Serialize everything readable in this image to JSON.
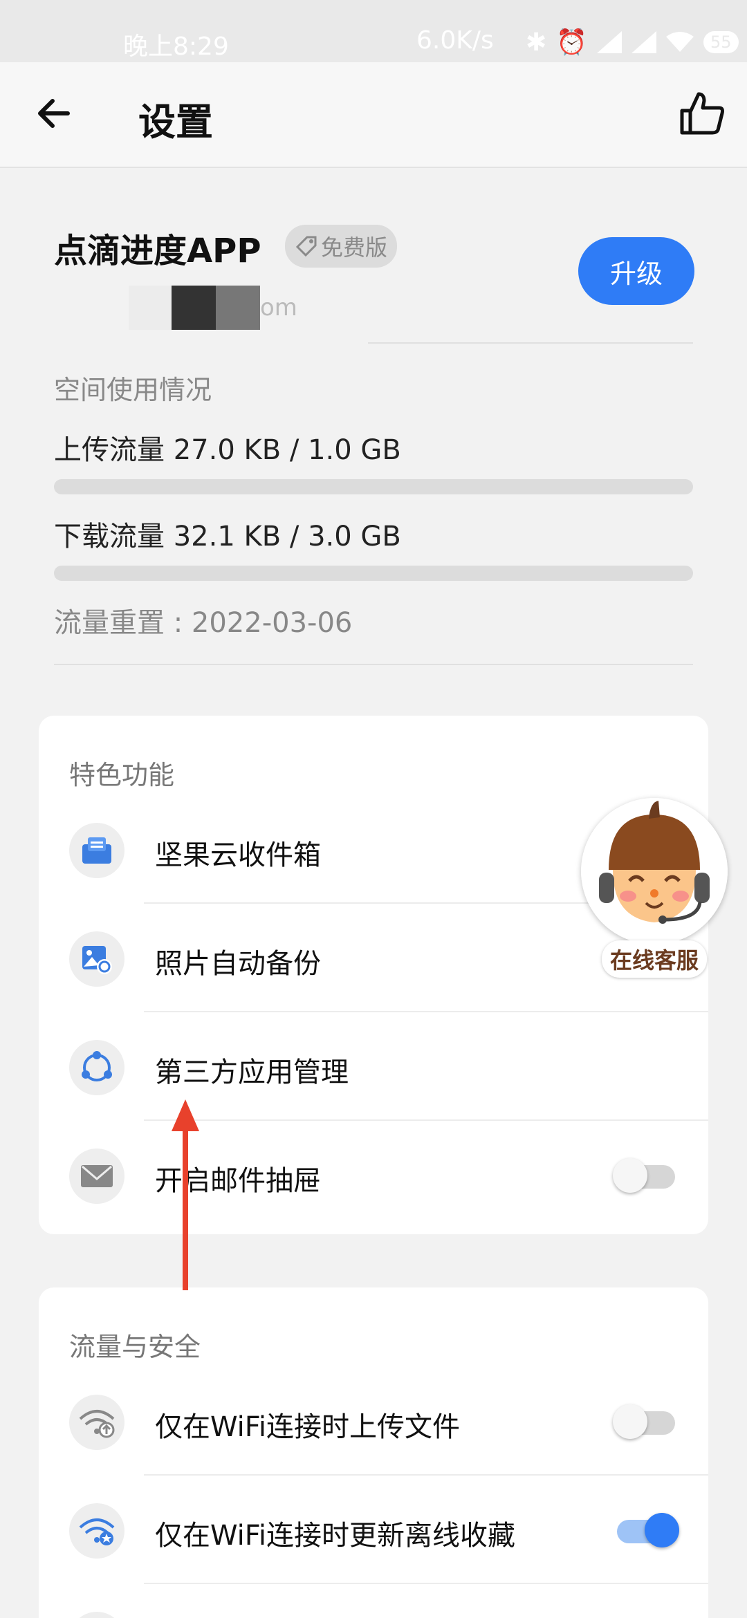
{
  "status_bar": {
    "time": "晚上8:29",
    "speed": "6.0K/s",
    "battery": "55"
  },
  "app_bar": {
    "title": "设置"
  },
  "account": {
    "app_name": "点滴进度APP",
    "badge": "免费版",
    "email_suffix": "om",
    "upgrade_label": "升级"
  },
  "usage": {
    "title": "空间使用情况",
    "upload_text": "上传流量 27.0 KB / 1.0 GB",
    "upload_fraction": 0.0,
    "download_text": "下载流量 32.1 KB / 3.0 GB",
    "download_fraction": 0.0,
    "reset_text": "流量重置 : 2022-03-06"
  },
  "features": {
    "title": "特色功能",
    "items": [
      {
        "label": "坚果云收件箱",
        "icon": "inbox-icon"
      },
      {
        "label": "照片自动备份",
        "icon": "photo-backup-icon"
      },
      {
        "label": "第三方应用管理",
        "icon": "third-party-apps-icon"
      },
      {
        "label": "开启邮件抽屉",
        "icon": "mail-icon",
        "toggle": false
      }
    ]
  },
  "traffic": {
    "title": "流量与安全",
    "items": [
      {
        "label": "仅在WiFi连接时上传文件",
        "icon": "wifi-upload-icon",
        "toggle": false
      },
      {
        "label": "仅在WiFi连接时更新离线收藏",
        "icon": "wifi-star-icon",
        "toggle": true
      }
    ]
  },
  "online_service": {
    "label": "在线客服"
  },
  "colors": {
    "accent": "#2f7cf6",
    "arrow": "#e8412c"
  }
}
